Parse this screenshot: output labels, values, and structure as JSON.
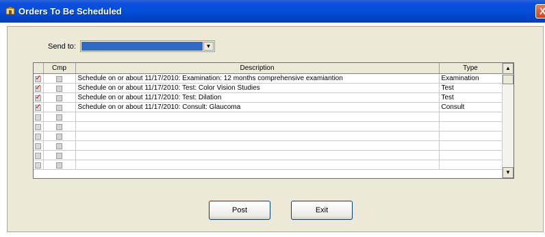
{
  "window": {
    "title": "Orders To Be Scheduled",
    "close_label": "X"
  },
  "form": {
    "send_to_label": "Send to:",
    "send_to_value": "",
    "dropdown_arrow": "▼"
  },
  "table": {
    "columns": [
      "",
      "Cmp",
      "Description",
      "Type"
    ],
    "rows": [
      {
        "checked": true,
        "description": "Schedule on or about 11/17/2010:  Examination: 12 months comprehensive examiantion",
        "type": "Examination"
      },
      {
        "checked": true,
        "description": "Schedule on or about 11/17/2010:  Test: Color Vision Studies",
        "type": "Test"
      },
      {
        "checked": true,
        "description": "Schedule on or about 11/17/2010:  Test: Dilation",
        "type": "Test"
      },
      {
        "checked": true,
        "description": "Schedule on or about 11/17/2010:  Consult: Glaucoma",
        "type": "Consult"
      },
      {
        "checked": false,
        "description": "",
        "type": ""
      },
      {
        "checked": false,
        "description": "",
        "type": ""
      },
      {
        "checked": false,
        "description": "",
        "type": ""
      },
      {
        "checked": false,
        "description": "",
        "type": ""
      },
      {
        "checked": false,
        "description": "",
        "type": ""
      },
      {
        "checked": false,
        "description": "",
        "type": ""
      }
    ],
    "scroll_up": "▲",
    "scroll_down": "▼"
  },
  "buttons": {
    "post_label": "Post",
    "exit_label": "Exit"
  },
  "colors": {
    "titlebar": "#0350d8",
    "selection": "#316ac5",
    "check": "#cc1010",
    "panel": "#ece9d8"
  }
}
